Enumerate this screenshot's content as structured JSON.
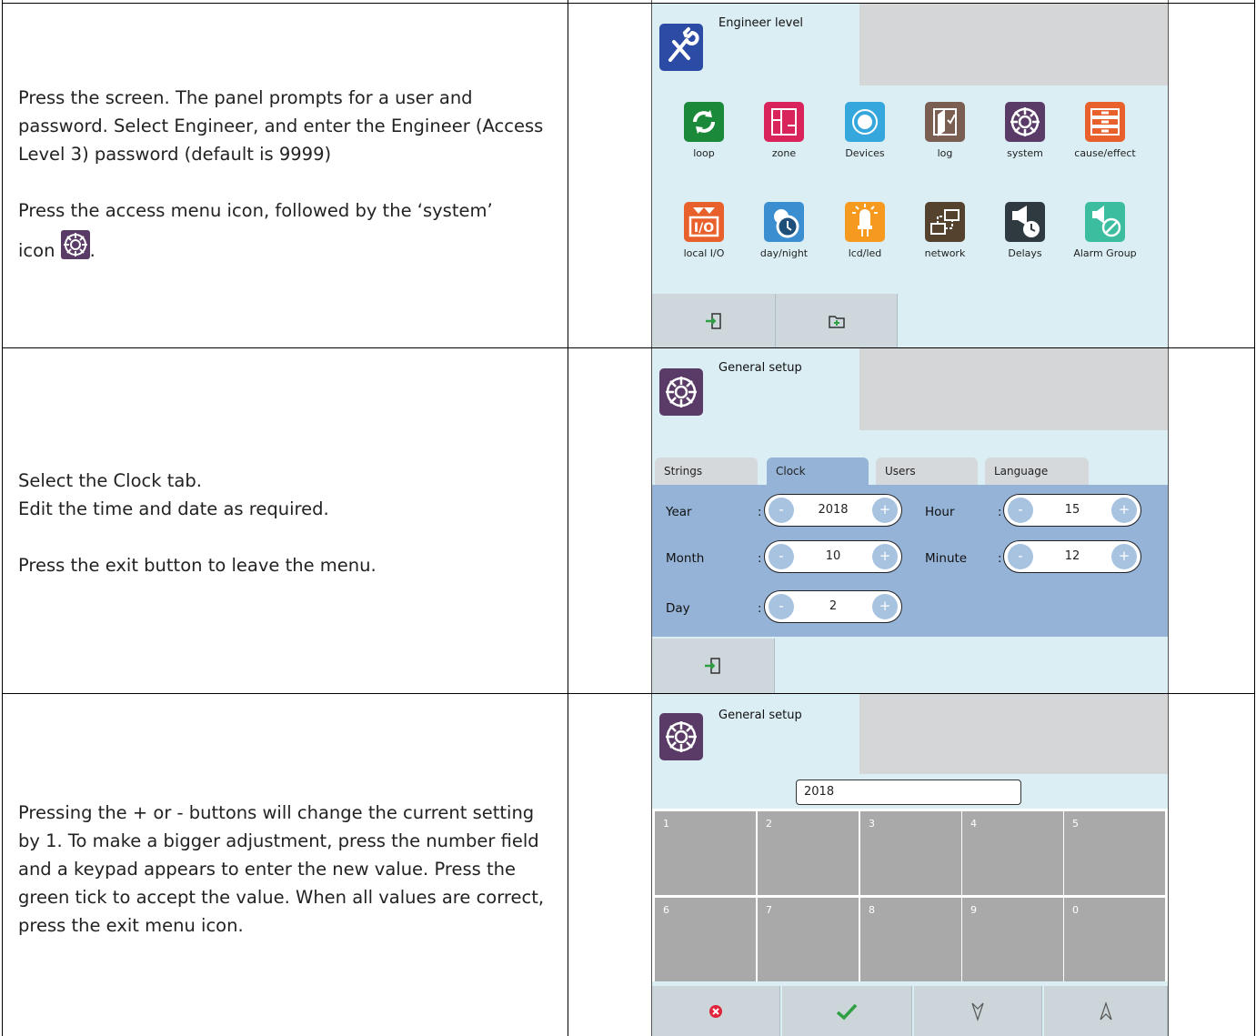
{
  "steps": [
    {
      "paragraph1": "Press the screen. The panel prompts for a user and password. Select Engineer, and enter the Engineer (Access Level 3) password (default is 9999)",
      "paragraph2_prefix": "Press the access menu icon, followed by the ‘system’",
      "paragraph2_icon_word": "icon",
      "paragraph2_suffix": "."
    },
    {
      "line1": "Select the Clock tab.",
      "line2": "Edit the time and date as required.",
      "line3": "Press the exit button to leave the menu."
    },
    {
      "paragraph": "Pressing the + or - buttons will change the current setting by 1. To make a bigger adjustment, press the number field and a keypad appears to enter the new value. Press the green tick to accept the value. When all values are correct, press the exit menu icon."
    }
  ],
  "screen1": {
    "title": "Engineer level",
    "icons": [
      {
        "label": "loop",
        "icon": "loop-icon",
        "color": "#1a8a3a"
      },
      {
        "label": "zone",
        "icon": "zone-icon",
        "color": "#d8245a"
      },
      {
        "label": "Devices",
        "icon": "devices-icon",
        "color": "#36a7dc"
      },
      {
        "label": "log",
        "icon": "log-icon",
        "color": "#7a5e52"
      },
      {
        "label": "system",
        "icon": "system-icon",
        "color": "#5a3a67"
      },
      {
        "label": "cause/effect",
        "icon": "cause-effect-icon",
        "color": "#e8612c"
      },
      {
        "label": "local I/O",
        "icon": "local-io-icon",
        "color": "#e8612c"
      },
      {
        "label": "day/night",
        "icon": "day-night-icon",
        "color": "#3b8fd0"
      },
      {
        "label": "lcd/led",
        "icon": "lcd-led-icon",
        "color": "#f59a1f"
      },
      {
        "label": "network",
        "icon": "network-icon",
        "color": "#54412e"
      },
      {
        "label": "Delays",
        "icon": "delays-icon",
        "color": "#2f3940"
      },
      {
        "label": "Alarm Group",
        "icon": "alarm-group-icon",
        "color": "#3cbda0"
      }
    ]
  },
  "screen2": {
    "title": "General setup",
    "tabs": [
      "Strings",
      "Clock",
      "Users",
      "Language"
    ],
    "active_tab": "Clock",
    "fields": {
      "year": {
        "label": "Year",
        "value": "2018"
      },
      "month": {
        "label": "Month",
        "value": "10"
      },
      "day": {
        "label": "Day",
        "value": "2"
      },
      "hour": {
        "label": "Hour",
        "value": "15"
      },
      "minute": {
        "label": "Minute",
        "value": "12"
      }
    },
    "colon": ":",
    "minus": "-",
    "plus": "+"
  },
  "screen3": {
    "title": "General setup",
    "input_value": "2018",
    "keys": [
      "1",
      "2",
      "3",
      "4",
      "5",
      "6",
      "7",
      "8",
      "9",
      "0"
    ]
  },
  "colors": {
    "panel_bg": "#daeef4",
    "clock_bg": "#94b3d6",
    "key_bg": "#a9a9a9",
    "system_purple": "#5a3a67",
    "engineer_blue": "#2b4ba5"
  }
}
